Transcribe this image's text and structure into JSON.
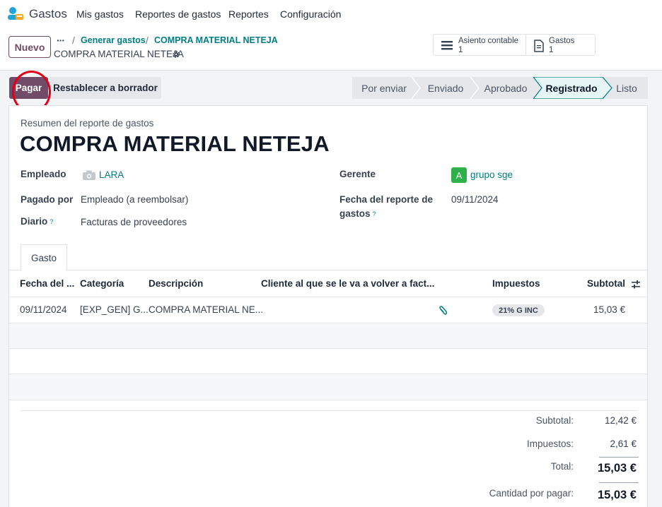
{
  "navbar": {
    "app_name": "Gastos",
    "menu": [
      "Mis gastos",
      "Reportes de gastos",
      "Reportes",
      "Configuración"
    ]
  },
  "control": {
    "new_button": "Nuevo",
    "breadcrumb_dots": "···",
    "breadcrumb": [
      "Generar gastos",
      "COMPRA MATERIAL NETEJA"
    ],
    "record_title": "COMPRA MATERIAL NETEJA",
    "smart_buttons": [
      {
        "label": "Asiento contable",
        "count": "1",
        "icon": "list-icon"
      },
      {
        "label": "Gastos",
        "count": "1",
        "icon": "document-icon"
      }
    ]
  },
  "actions": {
    "pay": "Pagar",
    "reset": "Restablecer a borrador"
  },
  "statusbar": {
    "stages": [
      "Por enviar",
      "Enviado",
      "Aprobado",
      "Registrado",
      "Listo"
    ],
    "active": "Registrado"
  },
  "sheet": {
    "subtitle": "Resumen del reporte de gastos",
    "title": "COMPRA MATERIAL NETEJA",
    "fields": {
      "employee_label": "Empleado",
      "employee_value": "LARA",
      "paid_by_label": "Pagado por",
      "paid_by_value": "Empleado (a reembolsar)",
      "journal_label": "Diario",
      "journal_value": "Facturas de proveedores",
      "manager_label": "Gerente",
      "manager_avatar": "A",
      "manager_value": "grupo sge",
      "report_date_label_1": "Fecha del reporte de",
      "report_date_label_2": "gastos",
      "report_date_value": "09/11/2024",
      "help_mark": "?"
    },
    "tab": "Gasto",
    "table": {
      "headers": [
        "Fecha del ...",
        "Categoría",
        "Descripción",
        "Cliente al que se le va a volver a fact...",
        "Impuestos",
        "Subtotal"
      ],
      "rows": [
        {
          "date": "09/11/2024",
          "category": "[EXP_GEN] G...",
          "description": "COMPRA MATERIAL NE...",
          "customer": "",
          "taxes": "21% G INC",
          "subtotal": "15,03 €"
        }
      ]
    },
    "totals": {
      "subtotal_label": "Subtotal:",
      "subtotal_value": "12,42 €",
      "taxes_label": "Impuestos:",
      "taxes_value": "2,61 €",
      "total_label": "Total:",
      "total_value": "15,03 €",
      "due_label": "Cantidad por pagar:",
      "due_value": "15,03 €"
    }
  },
  "colors": {
    "primary": "#714b67",
    "link": "#017e84",
    "highlight": "#e0001a",
    "avatar": "#2fb149"
  }
}
